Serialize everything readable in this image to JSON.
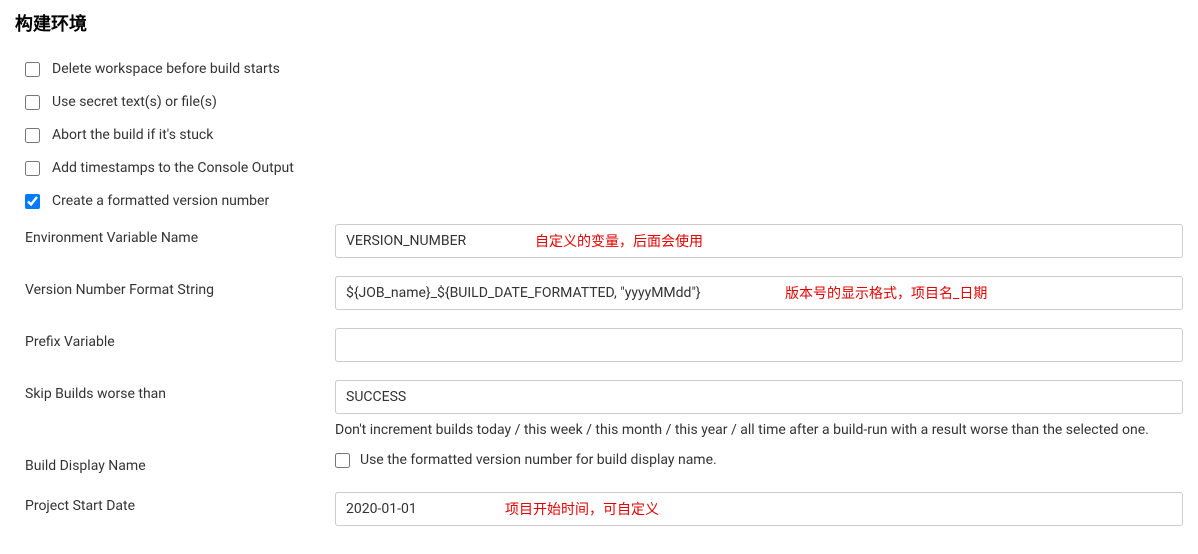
{
  "section": {
    "title": "构建环境"
  },
  "checkboxes": {
    "delete_workspace": {
      "label": "Delete workspace before build starts",
      "checked": false
    },
    "use_secret": {
      "label": "Use secret text(s) or file(s)",
      "checked": false
    },
    "abort_stuck": {
      "label": "Abort the build if it's stuck",
      "checked": false
    },
    "add_timestamps": {
      "label": "Add timestamps to the Console Output",
      "checked": false
    },
    "create_version": {
      "label": "Create a formatted version number",
      "checked": true
    }
  },
  "form": {
    "env_var_name": {
      "label": "Environment Variable Name",
      "value": "VERSION_NUMBER",
      "annotation": "自定义的变量，后面会使用"
    },
    "format_string": {
      "label": "Version Number Format String",
      "value": "${JOB_name}_${BUILD_DATE_FORMATTED, \"yyyyMMdd\"}",
      "annotation": "版本号的显示格式，项目名_日期"
    },
    "prefix_var": {
      "label": "Prefix Variable",
      "value": ""
    },
    "skip_builds": {
      "label": "Skip Builds worse than",
      "value": "SUCCESS",
      "help": "Don't increment builds today / this week / this month / this year / all time after a build-run with a result worse than the selected one."
    },
    "build_display": {
      "label": "Build Display Name",
      "checkbox_label": "Use the formatted version number for build display name.",
      "checked": false
    },
    "start_date": {
      "label": "Project Start Date",
      "value": "2020-01-01",
      "annotation": "项目开始时间，可自定义"
    }
  }
}
